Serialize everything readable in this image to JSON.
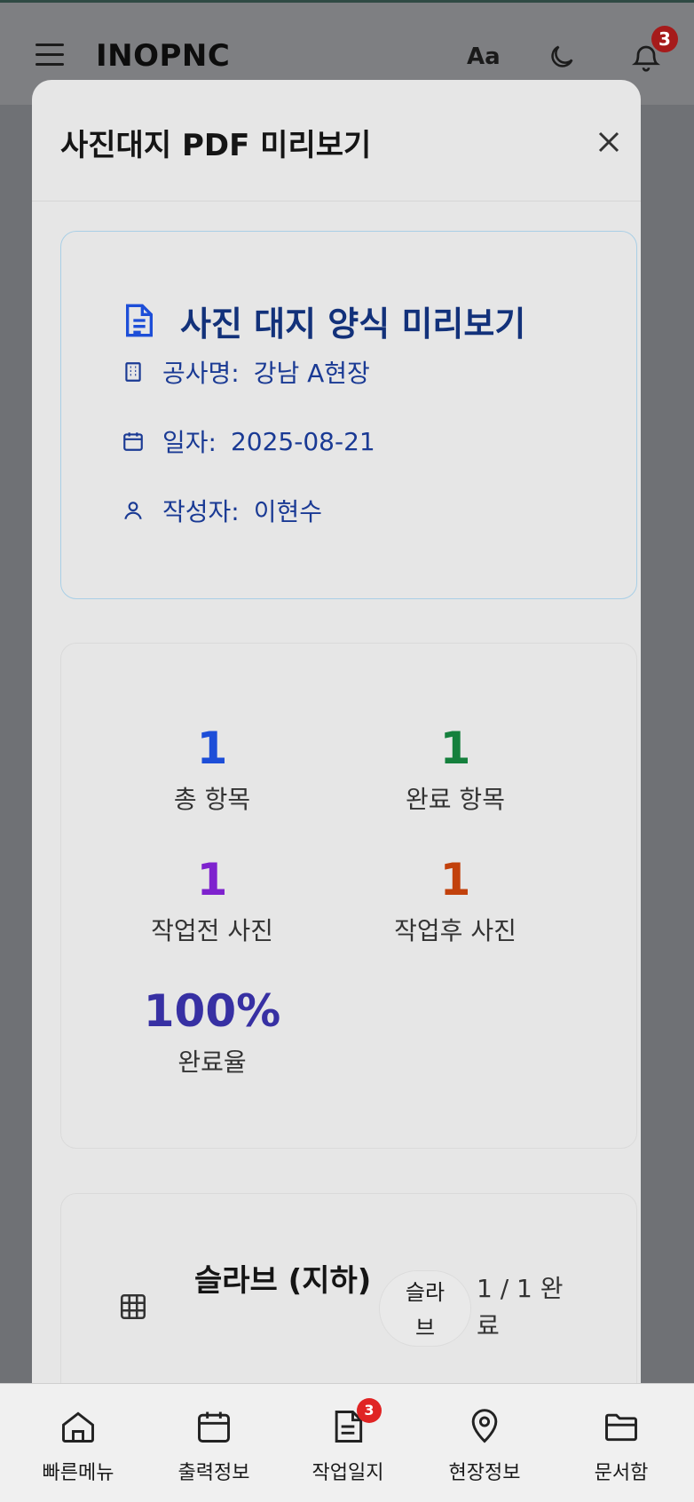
{
  "appbar": {
    "title": "INOPNC",
    "font_button": "Aa",
    "notification_count": "3",
    "icons": [
      "menu-icon",
      "moon-icon",
      "bell-icon"
    ]
  },
  "modal": {
    "title": "사진대지 PDF 미리보기",
    "close_icon": "close-icon"
  },
  "info": {
    "title": "사진 대지 양식 미리보기",
    "site_label": "공사명:",
    "site_value": "강남 A현장",
    "date_label": "일자:",
    "date_value": "2025-08-21",
    "author_label": "작성자:",
    "author_value": "이현수"
  },
  "stats": {
    "total": {
      "value": "1",
      "label": "총 항목",
      "color": "#1d4ed8"
    },
    "done": {
      "value": "1",
      "label": "완료 항목",
      "color": "#15803d"
    },
    "before": {
      "value": "1",
      "label": "작업전 사진",
      "color": "#7e22ce"
    },
    "after": {
      "value": "1",
      "label": "작업후 사진",
      "color": "#c2410c"
    },
    "rate": {
      "value": "100%",
      "label": "완료율",
      "color": "#3730a3"
    }
  },
  "section": {
    "title": "슬라브 (지하)",
    "chip": "슬라브",
    "progress": "1 / 1 완료"
  },
  "bottom_nav": {
    "items": [
      {
        "label": "빠른메뉴",
        "icon": "home-icon"
      },
      {
        "label": "출력정보",
        "icon": "calendar-icon"
      },
      {
        "label": "작업일지",
        "icon": "document-icon",
        "badge": "3"
      },
      {
        "label": "현장정보",
        "icon": "map-pin-icon"
      },
      {
        "label": "문서함",
        "icon": "folder-icon"
      }
    ]
  }
}
